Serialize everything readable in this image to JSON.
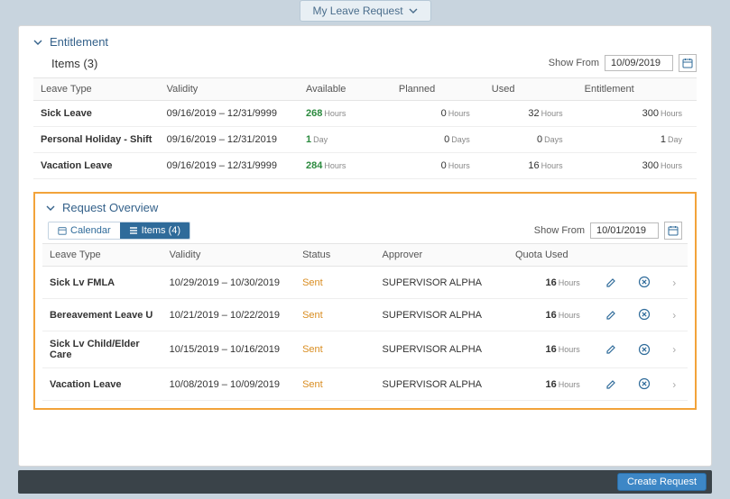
{
  "topPill": {
    "label": "My Leave Request"
  },
  "entitlement": {
    "title": "Entitlement",
    "itemsLabel": "Items (3)",
    "showFromLabel": "Show From",
    "showFromDate": "10/09/2019",
    "columns": {
      "leaveType": "Leave Type",
      "validity": "Validity",
      "available": "Available",
      "planned": "Planned",
      "used": "Used",
      "entitlement": "Entitlement"
    },
    "rows": [
      {
        "leaveType": "Sick Leave",
        "validity": "09/16/2019 – 12/31/9999",
        "available": "268",
        "availableUnit": "Hours",
        "planned": "0",
        "plannedUnit": "Hours",
        "used": "32",
        "usedUnit": "Hours",
        "entitlement": "300",
        "entitlementUnit": "Hours"
      },
      {
        "leaveType": "Personal Holiday - Shift",
        "validity": "09/16/2019 – 12/31/2019",
        "available": "1",
        "availableUnit": "Day",
        "planned": "0",
        "plannedUnit": "Days",
        "used": "0",
        "usedUnit": "Days",
        "entitlement": "1",
        "entitlementUnit": "Day"
      },
      {
        "leaveType": "Vacation Leave",
        "validity": "09/16/2019 – 12/31/9999",
        "available": "284",
        "availableUnit": "Hours",
        "planned": "0",
        "plannedUnit": "Hours",
        "used": "16",
        "usedUnit": "Hours",
        "entitlement": "300",
        "entitlementUnit": "Hours"
      }
    ]
  },
  "overview": {
    "title": "Request Overview",
    "calendarLabel": "Calendar",
    "itemsLabel": "Items (4)",
    "showFromLabel": "Show From",
    "showFromDate": "10/01/2019",
    "columns": {
      "leaveType": "Leave Type",
      "validity": "Validity",
      "status": "Status",
      "approver": "Approver",
      "quotaUsed": "Quota Used"
    },
    "rows": [
      {
        "leaveType": "Sick Lv FMLA",
        "validity": "10/29/2019 – 10/30/2019",
        "status": "Sent",
        "approver": "SUPERVISOR ALPHA",
        "quota": "16",
        "quotaUnit": "Hours"
      },
      {
        "leaveType": "Bereavement Leave U",
        "validity": "10/21/2019 – 10/22/2019",
        "status": "Sent",
        "approver": "SUPERVISOR ALPHA",
        "quota": "16",
        "quotaUnit": "Hours"
      },
      {
        "leaveType": "Sick Lv Child/Elder Care",
        "validity": "10/15/2019 – 10/16/2019",
        "status": "Sent",
        "approver": "SUPERVISOR ALPHA",
        "quota": "16",
        "quotaUnit": "Hours"
      },
      {
        "leaveType": "Vacation Leave",
        "validity": "10/08/2019 – 10/09/2019",
        "status": "Sent",
        "approver": "SUPERVISOR ALPHA",
        "quota": "16",
        "quotaUnit": "Hours"
      }
    ]
  },
  "footer": {
    "createLabel": "Create Request"
  }
}
